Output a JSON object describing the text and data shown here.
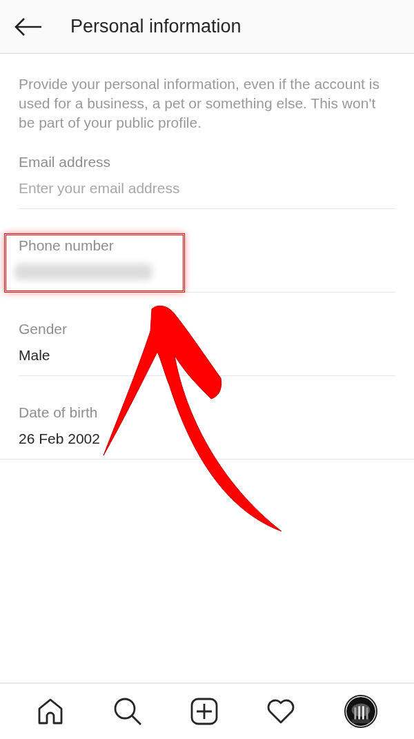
{
  "header": {
    "title": "Personal information"
  },
  "description": "Provide your personal information, even if the account is used for a business, a pet or something else. This won't be part of your public profile.",
  "fields": [
    {
      "kind": "input",
      "label": "Email address",
      "placeholder": "Enter your email address"
    },
    {
      "kind": "redacted",
      "label": "Phone number"
    },
    {
      "kind": "value",
      "label": "Gender",
      "value": "Male"
    },
    {
      "kind": "value",
      "label": "Date of birth",
      "value": "26 Feb 2002"
    }
  ],
  "annotations": {
    "highlight_box": true,
    "arrow": true
  },
  "nav": [
    {
      "kind": "home"
    },
    {
      "kind": "search"
    },
    {
      "kind": "add"
    },
    {
      "kind": "heart"
    },
    {
      "kind": "avatar"
    }
  ]
}
